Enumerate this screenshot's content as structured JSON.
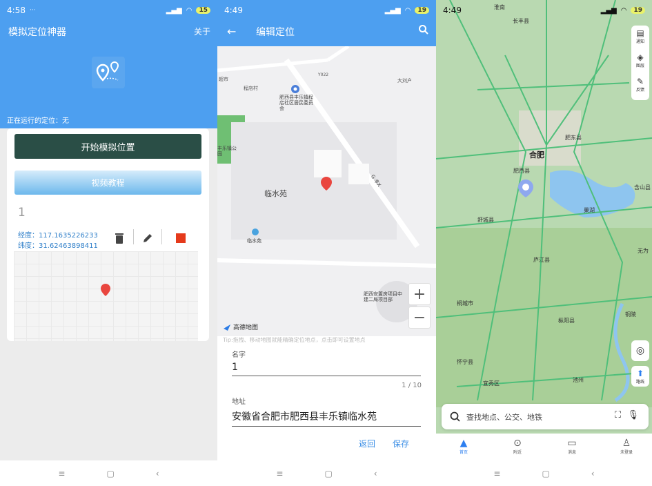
{
  "panel1": {
    "status": {
      "time": "4:58",
      "battery": "15"
    },
    "title": "模拟定位神器",
    "about": "关于",
    "running": "正在运行的定位：无",
    "start_button": "开始模拟位置",
    "video_button": "视频教程",
    "location_name": "1",
    "longitude": "经度：117.1635226233",
    "latitude": "纬度：31.62463898411"
  },
  "panel2": {
    "status": {
      "time": "4:49",
      "battery": "19"
    },
    "title": "编辑定位",
    "map_labels": {
      "a": "超市",
      "b": "程店村",
      "c": "Y022",
      "d": "大刘户",
      "e": "肥西县丰乐镇程店社区居民委员会",
      "f": "临水苑",
      "g": "临水苑",
      "h": "丰乐镇公园",
      "i": "肥西安置房项目中建二局项目部",
      "road": "G·丰X"
    },
    "map_brand": "高德地图",
    "tip": "Tip:拖拽、移动地图就能精确定位地点，点击即可设置地点",
    "name_label": "名字",
    "name_value": "1",
    "counter": "1 / 10",
    "address_label": "地址",
    "address_value": "安徽省合肥市肥西县丰乐镇临水苑",
    "return_button": "返回",
    "save_button": "保存"
  },
  "panel3": {
    "status": {
      "time": "4:49",
      "battery": "19"
    },
    "side_buttons": [
      "通知",
      "图层",
      "反馈"
    ],
    "route_button": "路线",
    "search_placeholder": "查找地点、公交、地铁",
    "tabs": [
      "首页",
      "附近",
      "消息",
      "未登录"
    ],
    "places": {
      "p1": "淮南",
      "p2": "长丰县",
      "p3": "合肥",
      "p4": "肥东县",
      "p5": "肥西县",
      "p6": "巢湖",
      "p7": "含山县",
      "p8": "舒城县",
      "p9": "庐江县",
      "p10": "无为",
      "p11": "桐城市",
      "p12": "铜陵",
      "p13": "枞阳县",
      "p14": "怀宁县",
      "p15": "宜秀区",
      "p16": "池州"
    }
  }
}
